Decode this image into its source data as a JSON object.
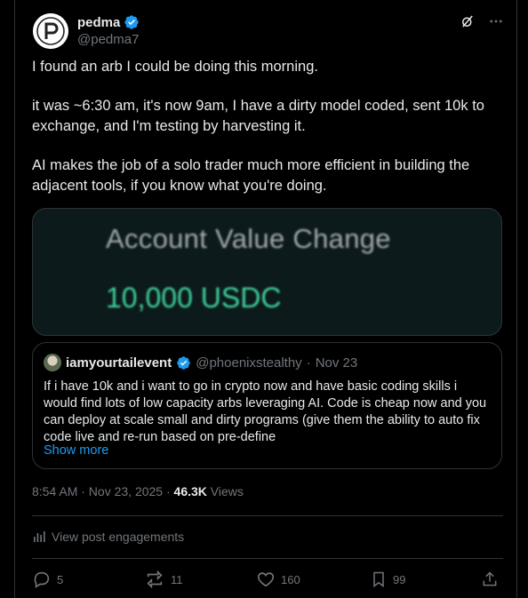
{
  "author": {
    "display_name": "pedma",
    "handle": "@pedma7",
    "verified": true
  },
  "tweet": {
    "paragraphs": [
      "I found an arb I could be doing this morning.",
      "it was ~6:30 am, it's now 9am, I have a dirty model coded, sent 10k to exchange, and I'm testing by harvesting it.",
      "AI makes the job of a solo trader much more efficient in building the adjacent tools, if you know what you're doing."
    ]
  },
  "media": {
    "title": "Account Value Change",
    "value": "10,000 USDC"
  },
  "quote": {
    "display_name": "iamyourtailevent",
    "handle": "@phoenixstealthy",
    "separator": "·",
    "date": "Nov 23",
    "text": "If i have 10k and i want to go in crypto now and have basic coding skills i would find lots of low capacity arbs leveraging AI. Code is cheap now and you can deploy at scale small and dirty programs (give them the ability to auto fix code live and re-run based on pre-define",
    "show_more": "Show more"
  },
  "meta": {
    "timestamp": "8:54 AM · Nov 23, 2025 · ",
    "views_count": "46.3K",
    "views_label": " Views"
  },
  "engagements_label": "View post engagements",
  "actions": {
    "replies": "5",
    "reposts": "11",
    "likes": "160",
    "bookmarks": "99"
  },
  "colors": {
    "background": "#000000",
    "text": "#e7e9ea",
    "muted": "#71767b",
    "accent": "#1d9bf0",
    "border": "#2f3336",
    "media_value": "#3fd39a"
  }
}
